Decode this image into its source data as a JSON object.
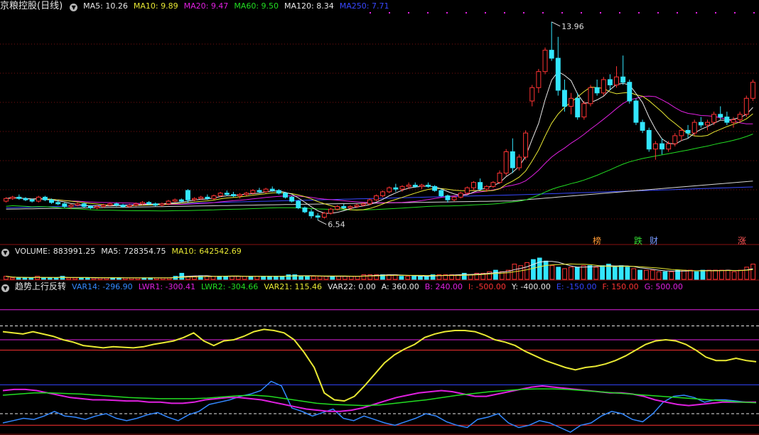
{
  "main": {
    "title": "京粮控股(日线)",
    "ma": [
      {
        "name": "MA5",
        "value": "10.26",
        "color": "#e8e8e8"
      },
      {
        "name": "MA10",
        "value": "9.89",
        "color": "#e8e833"
      },
      {
        "name": "MA20",
        "value": "9.47",
        "color": "#e020e0"
      },
      {
        "name": "MA60",
        "value": "9.50",
        "color": "#22dd22"
      },
      {
        "name": "MA120",
        "value": "8.34",
        "color": "#e8e8e8"
      },
      {
        "name": "MA250",
        "value": "7.71",
        "color": "#3848ff"
      }
    ],
    "high_label": "13.96",
    "low_label": "6.54",
    "tags": [
      {
        "text": "榜",
        "color": "#ff9933"
      },
      {
        "text": "跌",
        "color": "#33dd33"
      },
      {
        "text": "财",
        "color": "#7799ff"
      },
      {
        "text": "涨",
        "color": "#ff5555"
      }
    ]
  },
  "volume": {
    "title": "VOLUME:",
    "title_value": "883991.25",
    "ma5_label": "MA5:",
    "ma5_value": "728354.75",
    "ma10_label": "MA10:",
    "ma10_value": "642542.69"
  },
  "indicator": {
    "title": "趋势上行反转",
    "items": [
      {
        "name": "VAR14:",
        "value": "-296.90",
        "color": "#3388ff"
      },
      {
        "name": "LWR1:",
        "value": "-300.41",
        "color": "#e020e0"
      },
      {
        "name": "LWR2:",
        "value": "-304.66",
        "color": "#22dd22"
      },
      {
        "name": "VAR21:",
        "value": "115.46",
        "color": "#e8e833"
      },
      {
        "name": "VAR22:",
        "value": "0.00",
        "color": "#e8e8e8"
      },
      {
        "name": "A:",
        "value": "360.00",
        "color": "#e8e8e8"
      },
      {
        "name": "B:",
        "value": "240.00",
        "color": "#e020e0"
      },
      {
        "name": "I:",
        "value": "-500.00",
        "color": "#ff3333"
      },
      {
        "name": "Y:",
        "value": "-400.00",
        "color": "#e8e8e8"
      },
      {
        "name": "E:",
        "value": "-150.00",
        "color": "#3344ff"
      },
      {
        "name": "F:",
        "value": "150.00",
        "color": "#ff3333"
      },
      {
        "name": "G:",
        "value": "500.00",
        "color": "#e020e0"
      }
    ]
  },
  "chart_data": [
    {
      "type": "candlestick",
      "title": "京粮控股(日线)",
      "ylim": [
        6.0,
        14.3
      ],
      "high_point": 13.96,
      "low_point": 6.54,
      "candles": [
        [
          7.25,
          7.4,
          7.2,
          7.35
        ],
        [
          7.35,
          7.45,
          7.3,
          7.4
        ],
        [
          7.4,
          7.5,
          7.3,
          7.35
        ],
        [
          7.35,
          7.4,
          7.25,
          7.3
        ],
        [
          7.3,
          7.35,
          7.2,
          7.25
        ],
        [
          7.25,
          7.45,
          7.2,
          7.4
        ],
        [
          7.4,
          7.45,
          7.25,
          7.3
        ],
        [
          7.3,
          7.35,
          7.15,
          7.2
        ],
        [
          7.2,
          7.3,
          7.1,
          7.15
        ],
        [
          7.15,
          7.2,
          7.0,
          7.05
        ],
        [
          7.05,
          7.15,
          6.95,
          7.1
        ],
        [
          7.1,
          7.2,
          7.05,
          7.15
        ],
        [
          7.15,
          7.2,
          7.0,
          7.05
        ],
        [
          7.05,
          7.1,
          6.95,
          7.0
        ],
        [
          7.0,
          7.1,
          6.95,
          7.05
        ],
        [
          7.05,
          7.15,
          7.0,
          7.1
        ],
        [
          7.1,
          7.2,
          7.05,
          7.15
        ],
        [
          7.15,
          7.2,
          7.05,
          7.1
        ],
        [
          7.1,
          7.15,
          7.0,
          7.05
        ],
        [
          7.05,
          7.15,
          7.0,
          7.1
        ],
        [
          7.1,
          7.2,
          7.05,
          7.15
        ],
        [
          7.15,
          7.25,
          7.1,
          7.2
        ],
        [
          7.2,
          7.25,
          7.1,
          7.15
        ],
        [
          7.15,
          7.2,
          7.05,
          7.1
        ],
        [
          7.1,
          7.2,
          7.05,
          7.15
        ],
        [
          7.15,
          7.3,
          7.1,
          7.25
        ],
        [
          7.25,
          7.35,
          7.2,
          7.3
        ],
        [
          7.3,
          7.35,
          7.2,
          7.25
        ],
        [
          7.65,
          7.7,
          7.2,
          7.3
        ],
        [
          7.3,
          7.4,
          7.25,
          7.35
        ],
        [
          7.35,
          7.45,
          7.3,
          7.4
        ],
        [
          7.4,
          7.5,
          7.3,
          7.35
        ],
        [
          7.35,
          7.5,
          7.3,
          7.45
        ],
        [
          7.45,
          7.6,
          7.4,
          7.55
        ],
        [
          7.55,
          7.65,
          7.45,
          7.5
        ],
        [
          7.5,
          7.6,
          7.4,
          7.45
        ],
        [
          7.45,
          7.55,
          7.35,
          7.5
        ],
        [
          7.5,
          7.6,
          7.45,
          7.55
        ],
        [
          7.55,
          7.7,
          7.5,
          7.65
        ],
        [
          7.65,
          7.75,
          7.55,
          7.6
        ],
        [
          7.6,
          7.75,
          7.55,
          7.7
        ],
        [
          7.7,
          7.8,
          7.6,
          7.65
        ],
        [
          7.65,
          7.7,
          7.5,
          7.55
        ],
        [
          7.55,
          7.6,
          7.35,
          7.4
        ],
        [
          7.4,
          7.45,
          7.2,
          7.25
        ],
        [
          7.25,
          7.3,
          6.95,
          7.0
        ],
        [
          7.0,
          7.05,
          6.8,
          6.85
        ],
        [
          6.85,
          6.95,
          6.6,
          6.7
        ],
        [
          6.7,
          6.8,
          6.54,
          6.65
        ],
        [
          6.65,
          6.85,
          6.6,
          6.8
        ],
        [
          6.8,
          7.0,
          6.75,
          6.95
        ],
        [
          6.95,
          7.1,
          6.9,
          7.05
        ],
        [
          7.05,
          7.15,
          6.95,
          7.0
        ],
        [
          7.0,
          7.1,
          6.9,
          7.05
        ],
        [
          7.05,
          7.15,
          7.0,
          7.1
        ],
        [
          7.1,
          7.2,
          7.05,
          7.15
        ],
        [
          7.15,
          7.35,
          7.1,
          7.3
        ],
        [
          7.3,
          7.5,
          7.25,
          7.45
        ],
        [
          7.45,
          7.65,
          7.4,
          7.6
        ],
        [
          7.6,
          7.8,
          7.55,
          7.75
        ],
        [
          7.75,
          7.9,
          7.6,
          7.7
        ],
        [
          7.7,
          7.85,
          7.6,
          7.8
        ],
        [
          7.8,
          7.95,
          7.7,
          7.85
        ],
        [
          7.85,
          7.95,
          7.75,
          7.8
        ],
        [
          7.8,
          7.9,
          7.7,
          7.85
        ],
        [
          7.85,
          7.95,
          7.75,
          7.8
        ],
        [
          7.8,
          7.85,
          7.6,
          7.65
        ],
        [
          7.65,
          7.7,
          7.4,
          7.45
        ],
        [
          7.45,
          7.5,
          7.2,
          7.3
        ],
        [
          7.3,
          7.45,
          7.25,
          7.4
        ],
        [
          7.4,
          7.6,
          7.35,
          7.55
        ],
        [
          7.55,
          7.8,
          7.5,
          7.75
        ],
        [
          7.75,
          8.0,
          7.65,
          7.95
        ],
        [
          7.95,
          8.1,
          7.65,
          7.7
        ],
        [
          7.7,
          7.85,
          7.6,
          7.8
        ],
        [
          7.8,
          8.0,
          7.75,
          7.95
        ],
        [
          7.95,
          8.4,
          7.9,
          8.3
        ],
        [
          8.3,
          9.2,
          8.2,
          9.1
        ],
        [
          9.1,
          9.6,
          8.3,
          8.5
        ],
        [
          8.5,
          9.0,
          8.4,
          8.9
        ],
        [
          8.9,
          9.9,
          8.8,
          9.8
        ],
        [
          11.0,
          11.6,
          10.8,
          11.5
        ],
        [
          11.5,
          12.2,
          11.3,
          12.1
        ],
        [
          12.1,
          13.0,
          12.0,
          12.9
        ],
        [
          12.9,
          13.96,
          12.5,
          12.6
        ],
        [
          12.6,
          13.4,
          11.2,
          11.4
        ],
        [
          11.4,
          11.8,
          10.6,
          10.8
        ],
        [
          10.8,
          11.3,
          10.5,
          11.1
        ],
        [
          11.1,
          11.3,
          10.3,
          10.4
        ],
        [
          10.4,
          11.0,
          10.3,
          10.9
        ],
        [
          10.9,
          11.6,
          10.8,
          11.5
        ],
        [
          11.5,
          11.8,
          11.2,
          11.3
        ],
        [
          11.3,
          11.9,
          11.2,
          11.8
        ],
        [
          11.8,
          12.0,
          11.4,
          11.6
        ],
        [
          11.6,
          12.3,
          11.5,
          11.9
        ],
        [
          11.9,
          12.7,
          11.6,
          11.7
        ],
        [
          11.7,
          11.8,
          10.9,
          11.0
        ],
        [
          11.0,
          11.1,
          10.1,
          10.2
        ],
        [
          10.2,
          10.3,
          9.8,
          9.9
        ],
        [
          9.9,
          10.0,
          9.1,
          9.2
        ],
        [
          9.2,
          9.5,
          8.8,
          9.4
        ],
        [
          9.4,
          9.6,
          9.0,
          9.2
        ],
        [
          9.2,
          9.5,
          9.1,
          9.4
        ],
        [
          9.4,
          9.8,
          9.3,
          9.7
        ],
        [
          9.7,
          10.0,
          9.5,
          9.9
        ],
        [
          9.9,
          10.1,
          9.6,
          9.8
        ],
        [
          9.8,
          10.3,
          9.7,
          10.2
        ],
        [
          10.2,
          10.4,
          10.0,
          10.1
        ],
        [
          10.1,
          10.3,
          9.9,
          10.2
        ],
        [
          10.2,
          10.6,
          10.1,
          10.5
        ],
        [
          10.5,
          10.8,
          10.3,
          10.4
        ],
        [
          10.4,
          10.6,
          10.1,
          10.2
        ],
        [
          10.2,
          10.4,
          10.0,
          10.3
        ],
        [
          10.3,
          10.6,
          10.2,
          10.5
        ],
        [
          10.5,
          11.2,
          10.4,
          11.1
        ],
        [
          11.1,
          11.8,
          11.0,
          11.7
        ]
      ]
    },
    {
      "type": "bar",
      "title": "VOLUME",
      "values": [
        2,
        1,
        1,
        1,
        1,
        2,
        1,
        1,
        1,
        2,
        1,
        1,
        1,
        1,
        1,
        1,
        1,
        1,
        1,
        1,
        1,
        1,
        1,
        1,
        1,
        1,
        1,
        2,
        4,
        2,
        2,
        2,
        2,
        2,
        2,
        2,
        2,
        2,
        2,
        2,
        2,
        2,
        2,
        2,
        2,
        3,
        3,
        2,
        2,
        2,
        2,
        2,
        2,
        2,
        2,
        2,
        2,
        3,
        3,
        3,
        3,
        3,
        3,
        2,
        2,
        2,
        2,
        2,
        3,
        3,
        3,
        3,
        3,
        4,
        3,
        4,
        4,
        5,
        6,
        5,
        6,
        10,
        9,
        11,
        13,
        14,
        12,
        9,
        8,
        7,
        8,
        8,
        9,
        9,
        8,
        9,
        10,
        8,
        9,
        8,
        7,
        6,
        6,
        6,
        5,
        5,
        5,
        6,
        6,
        6,
        5,
        6,
        6,
        6,
        6,
        6,
        5,
        6,
        8,
        10
      ]
    },
    {
      "type": "line",
      "title": "趋势上行反转",
      "ylim": [
        -560,
        640
      ],
      "reference_lines": {
        "G": 500,
        "A": 360,
        "B": 240,
        "F": 150,
        "E": -150,
        "Y": -400,
        "I": -500
      },
      "series": [
        {
          "name": "VAR21",
          "color": "#e8e833",
          "values": [
            310,
            300,
            290,
            310,
            290,
            270,
            240,
            220,
            190,
            180,
            170,
            180,
            175,
            170,
            180,
            200,
            215,
            230,
            260,
            300,
            230,
            190,
            230,
            240,
            270,
            310,
            330,
            320,
            300,
            240,
            130,
            0,
            -220,
            -280,
            -290,
            -250,
            -160,
            -60,
            40,
            110,
            160,
            200,
            260,
            290,
            310,
            320,
            320,
            310,
            280,
            240,
            220,
            190,
            140,
            100,
            60,
            30,
            0,
            -20,
            0,
            10,
            30,
            60,
            100,
            150,
            200,
            230,
            240,
            230,
            200,
            150,
            90,
            60,
            60,
            80,
            60,
            50
          ]
        },
        {
          "name": "VAR14",
          "color": "#3388ff",
          "values": [
            -480,
            -460,
            -440,
            -450,
            -420,
            -380,
            -420,
            -430,
            -450,
            -420,
            -400,
            -440,
            -460,
            -440,
            -410,
            -390,
            -430,
            -460,
            -410,
            -380,
            -320,
            -300,
            -280,
            -250,
            -230,
            -200,
            -120,
            -160,
            -350,
            -380,
            -420,
            -390,
            -360,
            -440,
            -460,
            -420,
            -450,
            -480,
            -500,
            -470,
            -440,
            -400,
            -420,
            -470,
            -500,
            -520,
            -450,
            -430,
            -400,
            -480,
            -520,
            -500,
            -460,
            -480,
            -520,
            -560,
            -500,
            -480,
            -420,
            -380,
            -400,
            -450,
            -470,
            -400,
            -300,
            -250,
            -240,
            -260,
            -300,
            -280,
            -280,
            -290,
            -300,
            -300
          ]
        },
        {
          "name": "LWR1",
          "color": "#e020e0",
          "values": [
            -200,
            -190,
            -190,
            -200,
            -220,
            -240,
            -260,
            -270,
            -280,
            -280,
            -285,
            -290,
            -290,
            -300,
            -300,
            -310,
            -310,
            -300,
            -280,
            -270,
            -260,
            -260,
            -270,
            -280,
            -300,
            -320,
            -340,
            -360,
            -370,
            -380,
            -380,
            -370,
            -350,
            -320,
            -290,
            -260,
            -240,
            -220,
            -210,
            -200,
            -210,
            -230,
            -250,
            -250,
            -230,
            -210,
            -190,
            -170,
            -160,
            -170,
            -180,
            -190,
            -200,
            -210,
            -220,
            -220,
            -230,
            -250,
            -280,
            -300,
            -320,
            -330,
            -320,
            -310,
            -300,
            -300,
            -300,
            -300
          ]
        },
        {
          "name": "LWR2",
          "color": "#22dd22",
          "values": [
            -240,
            -230,
            -220,
            -220,
            -225,
            -230,
            -240,
            -250,
            -260,
            -265,
            -270,
            -270,
            -270,
            -265,
            -255,
            -245,
            -240,
            -250,
            -270,
            -290,
            -310,
            -320,
            -325,
            -330,
            -325,
            -310,
            -295,
            -280,
            -260,
            -240,
            -225,
            -210,
            -200,
            -190,
            -185,
            -185,
            -190,
            -200,
            -210,
            -220,
            -230,
            -240,
            -250,
            -260,
            -270,
            -280,
            -290,
            -300,
            -305
          ]
        }
      ]
    }
  ]
}
